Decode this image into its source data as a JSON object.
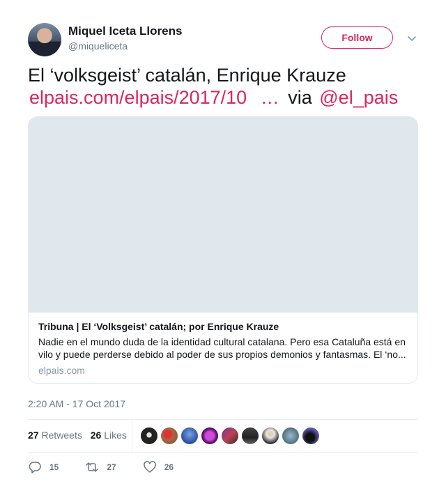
{
  "author": {
    "name": "Miquel Iceta Llorens",
    "handle": "@miqueliceta",
    "follow_label": "Follow"
  },
  "tweet": {
    "text": "El ‘volksgeist’ catalán, Enrique Krauze",
    "link": "elpais.com/elpais/2017/10",
    "ellipsis": "…",
    "via": "via",
    "mention": "@el_pais"
  },
  "card": {
    "title": "Tribuna | El ‘Volksgeist’ catalán; por Enrique Krauze",
    "description": "Nadie en el mundo duda de la identidad cultural catalana. Pero esa Cataluña está en vilo y puede perderse debido al poder de sus propios demonios y fantasmas. El ‘no...",
    "domain": "elpais.com"
  },
  "timestamp": "2:20 AM - 17 Oct 2017",
  "stats": {
    "retweets_count": "27",
    "retweets_label": "Retweets",
    "likes_count": "26",
    "likes_label": "Likes"
  },
  "actions": {
    "replies": "15",
    "retweets": "27",
    "likes": "26"
  },
  "colors": {
    "accent": "#e0245e",
    "muted": "#657786",
    "border": "#e1e8ed"
  }
}
